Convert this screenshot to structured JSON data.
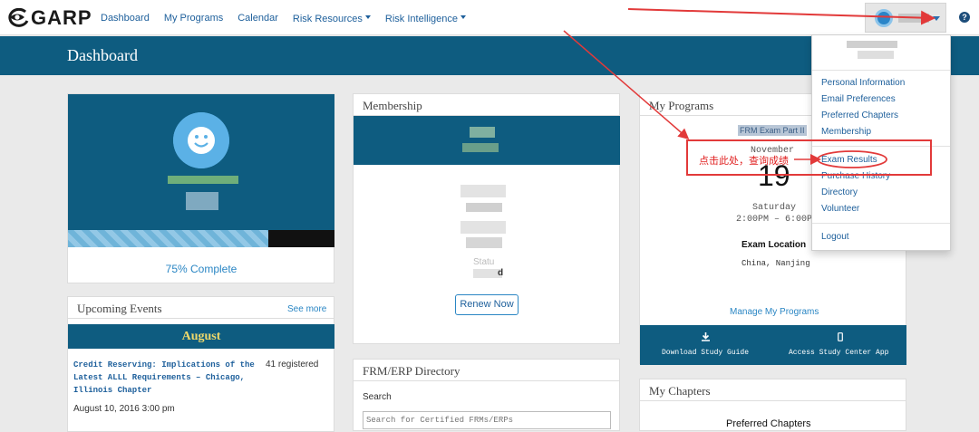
{
  "brand": {
    "name": "GARP"
  },
  "nav": {
    "links": [
      "Dashboard",
      "My Programs",
      "Calendar",
      "Risk Resources",
      "Risk Intelligence"
    ]
  },
  "header": {
    "title": "Dashboard"
  },
  "help_icon": "?",
  "profile": {
    "progress_label": "75% Complete",
    "progress_value": 0.75
  },
  "membership": {
    "title": "Membership",
    "status_partial": "Statu",
    "status_value_partial": "d",
    "renew_label": "Renew Now"
  },
  "programs": {
    "title": "My Programs",
    "exam_tag": "FRM Exam Part II",
    "month": "November",
    "day": "19",
    "weekday": "Saturday",
    "time": "2:00PM – 6:00PM",
    "location_label": "Exam Location",
    "location_value": "China, Nanjing",
    "manage_link": "Manage My Programs",
    "download_label": "Download Study Guide",
    "access_label": "Access Study Center App"
  },
  "events": {
    "title": "Upcoming Events",
    "see_more": "See more",
    "month": "August",
    "items": [
      {
        "title": "Credit Reserving: Implications of the Latest ALLL Requirements – Chicago, Illinois Chapter",
        "registered": "41 registered",
        "date": "August 10, 2016 3:00 pm"
      }
    ]
  },
  "directory": {
    "title": "FRM/ERP Directory",
    "search_label": "Search",
    "search_placeholder": "Search for Certified FRMs/ERPs"
  },
  "chapters": {
    "title": "My Chapters",
    "preferred_label": "Preferred Chapters"
  },
  "user_menu": {
    "items": [
      "Personal Information",
      "Email Preferences",
      "Preferred Chapters",
      "Membership",
      "Exam Results",
      "Purchase History",
      "Directory",
      "Volunteer",
      "Logout"
    ]
  },
  "annotation": {
    "text": "点击此处，查询成绩",
    "color": "#e23a3a"
  },
  "colors": {
    "brand_teal": "#0e5c80",
    "link_blue": "#1d5f9b",
    "accent_blue": "#2a86c4"
  }
}
